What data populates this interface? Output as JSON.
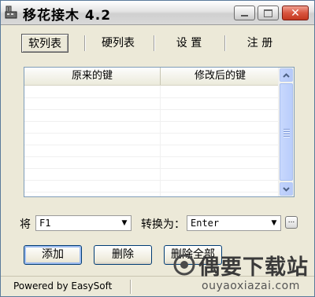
{
  "window": {
    "title": "移花接木 4.2",
    "controls": {
      "minimize": "minimize",
      "maximize": "maximize",
      "close": "✕"
    }
  },
  "tabs": [
    {
      "label": "软列表",
      "active": true
    },
    {
      "label": "硬列表",
      "active": false
    },
    {
      "label": "设 置",
      "active": false
    },
    {
      "label": "注 册",
      "active": false
    }
  ],
  "table": {
    "columns": [
      "原来的键",
      "修改后的键"
    ],
    "rows": []
  },
  "mapping": {
    "from_label": "将",
    "from_value": "F1",
    "to_label": "转换为：",
    "to_value": "Enter",
    "more_button": "..."
  },
  "buttons": {
    "add": "添加",
    "delete": "删除",
    "delete_all": "删除全部"
  },
  "status": {
    "text": "Powered by EasySoft"
  },
  "watermark": {
    "brand": "偶要下载站",
    "url": "ouyaoxiazai.com"
  },
  "colors": {
    "close_button": "#d8553f",
    "scrollbar": "#c2d3fc",
    "default_button_focus": "#9fbdf0"
  }
}
